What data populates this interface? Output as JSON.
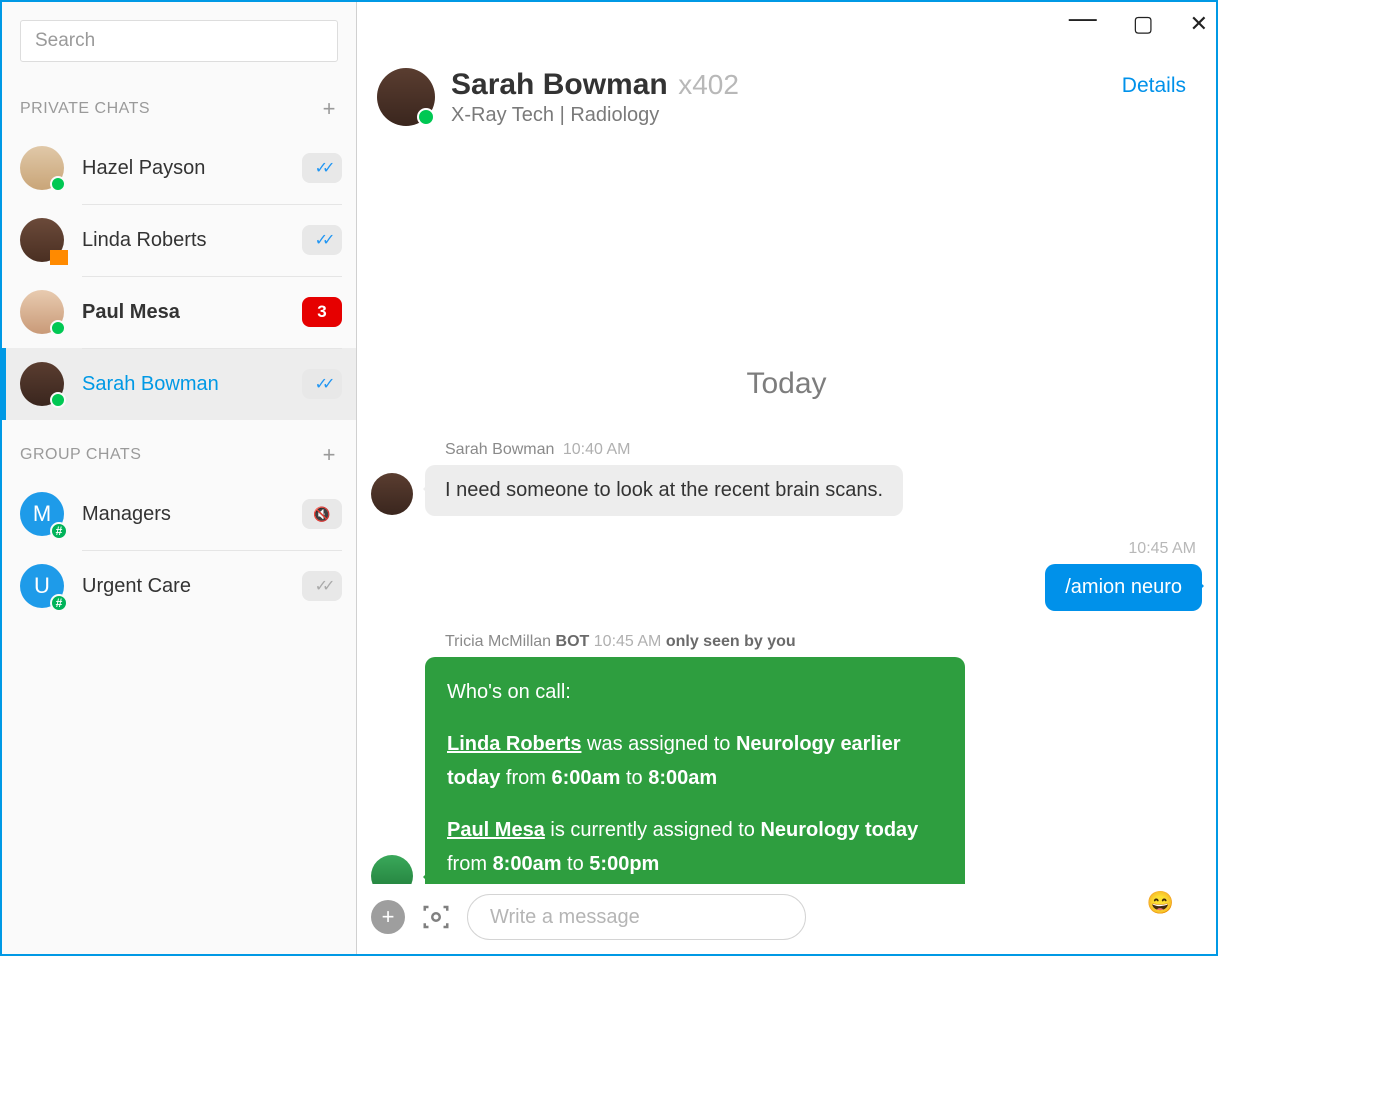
{
  "search": {
    "placeholder": "Search"
  },
  "sections": {
    "private": "PRIVATE CHATS",
    "group": "GROUP CHATS"
  },
  "privateChats": [
    {
      "name": "Hazel Payson",
      "presence": "online",
      "badge": "read"
    },
    {
      "name": "Linda Roberts",
      "presence": "away",
      "badge": "read"
    },
    {
      "name": "Paul Mesa",
      "presence": "online",
      "badge": "unread",
      "count": "3"
    },
    {
      "name": "Sarah Bowman",
      "presence": "online",
      "badge": "read",
      "selected": true
    }
  ],
  "groupChats": [
    {
      "initial": "M",
      "name": "Managers",
      "badge": "muted"
    },
    {
      "initial": "U",
      "name": "Urgent Care",
      "badge": "read-grey"
    }
  ],
  "header": {
    "name": "Sarah Bowman",
    "ext": "x402",
    "subtitle": "X-Ray Tech | Radiology",
    "details": "Details"
  },
  "dayDivider": "Today",
  "msg1": {
    "sender": "Sarah Bowman",
    "time": "10:40 AM",
    "text": "I need someone to look at the recent brain scans."
  },
  "outgoing": {
    "time": "10:45 AM",
    "text": "/amion neuro"
  },
  "botMsg": {
    "sender": "Tricia McMillan",
    "tag": "BOT",
    "time": "10:45 AM",
    "seen": "only seen by you",
    "lead": "Who's on call:",
    "p1_link": "Linda Roberts",
    "p1_a": " was assigned to ",
    "p1_b": "Neurology earlier today",
    "p1_c": " from ",
    "p1_d": "6:00am",
    "p1_e": " to ",
    "p1_f": "8:00am",
    "p2_link": "Paul Mesa",
    "p2_a": " is currently assigned to ",
    "p2_b": "Neurology today",
    "p2_c": " from ",
    "p2_d": "8:00am",
    "p2_e": " to ",
    "p2_f": "5:00pm"
  },
  "composer": {
    "placeholder": "Write a message"
  }
}
